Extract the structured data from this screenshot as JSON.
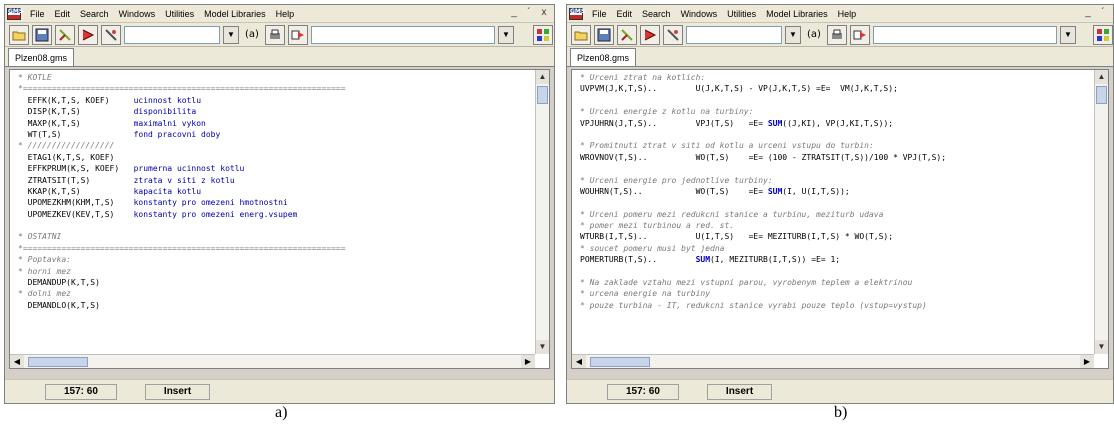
{
  "menu": [
    "File",
    "Edit",
    "Search",
    "Windows",
    "Utilities",
    "Model Libraries",
    "Help"
  ],
  "app_icon_text": "GMS",
  "window_controls": [
    "_",
    "´",
    "x"
  ],
  "toolbar": {
    "lib_label": "(a)"
  },
  "captions": {
    "a": "a)",
    "b": "b)"
  },
  "window_a": {
    "tab": "Plzen08.gms",
    "status": {
      "position": "157: 60",
      "mode": "Insert"
    },
    "lines": [
      {
        "type": "comment",
        "text": "* KOTLE"
      },
      {
        "type": "comment",
        "text": "*==================================================================="
      },
      {
        "type": "decl",
        "name": "EFFK(K,T,S, KOEF)",
        "desc": "ucinnost kotlu"
      },
      {
        "type": "decl",
        "name": "DISP(K,T,S)",
        "desc": "disponibilita"
      },
      {
        "type": "decl",
        "name": "MAXP(K,T,S)",
        "desc": "maximalni vykon"
      },
      {
        "type": "decl",
        "name": "WT(T,S)",
        "desc": "fond pracovni doby"
      },
      {
        "type": "comment",
        "text": "* //////////////////"
      },
      {
        "type": "decl",
        "name": "ETAG1(K,T,S, KOEF)",
        "desc": ""
      },
      {
        "type": "decl",
        "name": "EFFKPRUM(K,S, KOEF)",
        "desc": "prumerna ucinnost kotlu"
      },
      {
        "type": "decl",
        "name": "ZTRATSIT(T,S)",
        "desc": "ztrata v siti z kotlu"
      },
      {
        "type": "decl",
        "name": "KKAP(K,T,S)",
        "desc": "kapacita kotlu"
      },
      {
        "type": "decl",
        "name": "UPOMEZKHM(KHM,T,S)",
        "desc": "konstanty pro omezeni hmotnostni"
      },
      {
        "type": "decl",
        "name": "UPOMEZKEV(KEV,T,S)",
        "desc": "konstanty pro omezeni energ.vsupem"
      },
      {
        "type": "blank",
        "text": ""
      },
      {
        "type": "comment",
        "text": "* OSTATNI"
      },
      {
        "type": "comment",
        "text": "*==================================================================="
      },
      {
        "type": "comment",
        "text": "* Poptavka:"
      },
      {
        "type": "comment",
        "text": "* horni mez"
      },
      {
        "type": "decl",
        "name": "DEMANDUP(K,T,S)",
        "desc": ""
      },
      {
        "type": "comment",
        "text": "* dolni mez"
      },
      {
        "type": "decl",
        "name": "DEMANDLO(K,T,S)",
        "desc": ""
      }
    ]
  },
  "window_b": {
    "tab": "Plzen08.gms",
    "status": {
      "position": "157: 60",
      "mode": "Insert"
    },
    "lines": [
      {
        "type": "comment",
        "text": "* Urceni ztrat na kotlich:"
      },
      {
        "type": "code",
        "parts": [
          [
            "UVPVM(J,K,T,S)..        U(J,K,T,S) - VP(J,K,T,S) =E=  VM(J,K,T,S);",
            ""
          ]
        ]
      },
      {
        "type": "blank"
      },
      {
        "type": "comment",
        "text": "* Urceni energie z kotlu na turbiny:"
      },
      {
        "type": "code",
        "parts": [
          [
            "VPJUHRN(J,T,S)..        VPJ(T,S)   =E= ",
            ""
          ],
          [
            "SUM",
            "kw"
          ],
          [
            "((J,KI), VP(J,KI,T,S));",
            ""
          ]
        ]
      },
      {
        "type": "blank"
      },
      {
        "type": "comment",
        "text": "* Promitnuti ztrat v siti od kotlu a urceni vstupu do turbin:"
      },
      {
        "type": "code",
        "parts": [
          [
            "WROVNOV(T,S)..          WO(T,S)    =E= (100 - ZTRATSIT(T,S))/100 * VPJ(T,S);",
            ""
          ]
        ]
      },
      {
        "type": "blank"
      },
      {
        "type": "comment",
        "text": "* Urceni energie pro jednotlive turbiny:"
      },
      {
        "type": "code",
        "parts": [
          [
            "WOUHRN(T,S)..           WO(T,S)    =E= ",
            ""
          ],
          [
            "SUM",
            "kw"
          ],
          [
            "(I, U(I,T,S));",
            ""
          ]
        ]
      },
      {
        "type": "blank"
      },
      {
        "type": "comment",
        "text": "* Urceni pomeru mezi redukcni stanice a turbinu, meziturb udava"
      },
      {
        "type": "comment",
        "text": "* pomer mezi turbinou a red. st."
      },
      {
        "type": "code",
        "parts": [
          [
            "WTURB(I,T,S)..          U(I,T,S)   =E= MEZITURB(I,T,S) * WO(T,S);",
            ""
          ]
        ]
      },
      {
        "type": "comment",
        "text": "* soucet pomeru musi byt jedna"
      },
      {
        "type": "code",
        "parts": [
          [
            "POMERTURB(T,S)..        ",
            ""
          ],
          [
            "SUM",
            "kw"
          ],
          [
            "(I, MEZITURB(I,T,S)) =E= 1;",
            ""
          ]
        ]
      },
      {
        "type": "blank"
      },
      {
        "type": "comment",
        "text": "* Na zaklade vztahu mezi vstupni parou, vyrobenym teplem a elektrinou"
      },
      {
        "type": "comment",
        "text": "* urcena energie na turbiny"
      },
      {
        "type": "comment",
        "text": "* pouze turbina - IT, redukcni stanice vyrabi pouze teplo (vstup=vystup)"
      }
    ]
  }
}
